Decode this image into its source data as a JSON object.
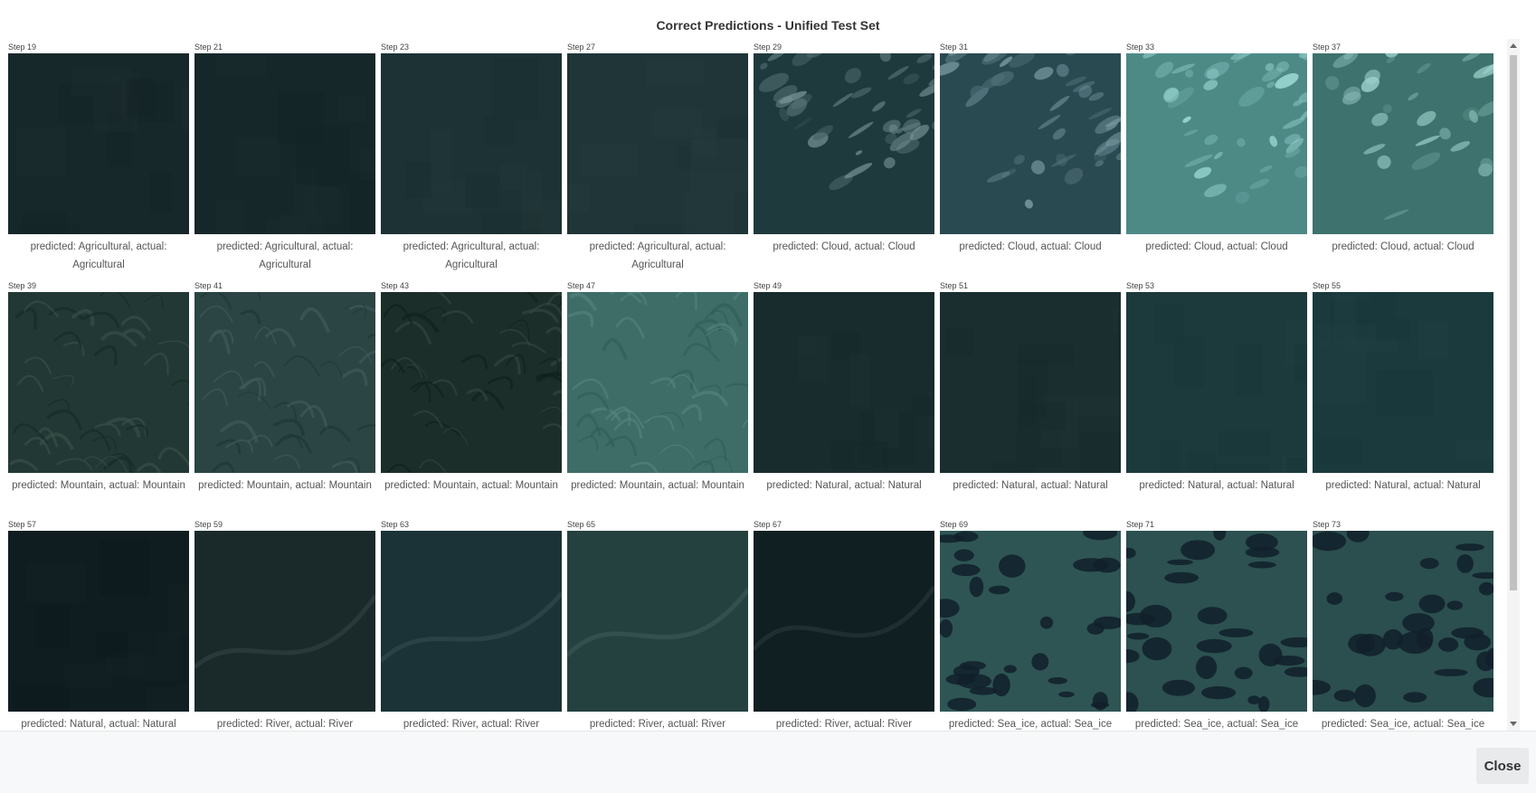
{
  "modal": {
    "title": "Correct Predictions - Unified Test Set",
    "close_label": "Close"
  },
  "panels": [
    {
      "step": "Step 19",
      "caption": "predicted: Agricultural, actual: Agricultural",
      "tone": "agri1"
    },
    {
      "step": "Step 21",
      "caption": "predicted: Agricultural, actual: Agricultural",
      "tone": "agri2"
    },
    {
      "step": "Step 23",
      "caption": "predicted: Agricultural, actual: Agricultural",
      "tone": "agri3"
    },
    {
      "step": "Step 27",
      "caption": "predicted: Agricultural, actual: Agricultural",
      "tone": "agri4"
    },
    {
      "step": "Step 29",
      "caption": "predicted: Cloud, actual: Cloud",
      "tone": "cloud1"
    },
    {
      "step": "Step 31",
      "caption": "predicted: Cloud, actual: Cloud",
      "tone": "cloud2"
    },
    {
      "step": "Step 33",
      "caption": "predicted: Cloud, actual: Cloud",
      "tone": "cloud3"
    },
    {
      "step": "Step 37",
      "caption": "predicted: Cloud, actual: Cloud",
      "tone": "cloud4"
    },
    {
      "step": "Step 39",
      "caption": "predicted: Mountain, actual: Mountain",
      "tone": "mtn1"
    },
    {
      "step": "Step 41",
      "caption": "predicted: Mountain, actual: Mountain",
      "tone": "mtn2"
    },
    {
      "step": "Step 43",
      "caption": "predicted: Mountain, actual: Mountain",
      "tone": "mtn3"
    },
    {
      "step": "Step 47",
      "caption": "predicted: Mountain, actual: Mountain",
      "tone": "mtn4"
    },
    {
      "step": "Step 49",
      "caption": "predicted: Natural, actual: Natural",
      "tone": "nat1"
    },
    {
      "step": "Step 51",
      "caption": "predicted: Natural, actual: Natural",
      "tone": "nat2"
    },
    {
      "step": "Step 53",
      "caption": "predicted: Natural, actual: Natural",
      "tone": "nat3"
    },
    {
      "step": "Step 55",
      "caption": "predicted: Natural, actual: Natural",
      "tone": "nat4"
    },
    {
      "step": "Step 57",
      "caption": "predicted: Natural, actual: Natural",
      "tone": "nat5"
    },
    {
      "step": "Step 59",
      "caption": "predicted: River, actual: River",
      "tone": "river1"
    },
    {
      "step": "Step 63",
      "caption": "predicted: River, actual: River",
      "tone": "river2"
    },
    {
      "step": "Step 65",
      "caption": "predicted: River, actual: River",
      "tone": "river3"
    },
    {
      "step": "Step 67",
      "caption": "predicted: River, actual: River",
      "tone": "river4"
    },
    {
      "step": "Step 69",
      "caption": "predicted: Sea_ice, actual: Sea_ice",
      "tone": "ice1"
    },
    {
      "step": "Step 71",
      "caption": "predicted: Sea_ice, actual: Sea_ice",
      "tone": "ice2"
    },
    {
      "step": "Step 73",
      "caption": "predicted: Sea_ice, actual: Sea_ice",
      "tone": "ice3"
    }
  ],
  "colors": {
    "agri1": "#17282a",
    "agri2": "#16272a",
    "agri3": "#1d3234",
    "agri4": "#1f3538",
    "cloud1": "#1f3a3d",
    "cloud2": "#2a4a52",
    "cloud3": "#4d8a86",
    "cloud4": "#3e726e",
    "mtn1": "#223834",
    "mtn2": "#2a4544",
    "mtn3": "#1c2e2a",
    "mtn4": "#3e6d68",
    "nat1": "#182b2d",
    "nat2": "#1a2e2f",
    "nat3": "#1c3a3c",
    "nat4": "#1a3a3d",
    "nat5": "#0f1d20",
    "river1": "#1a2a2b",
    "river2": "#1b3336",
    "river3": "#24413f",
    "river4": "#0f1f22",
    "ice1": "#2e5554",
    "ice2": "#2c5150",
    "ice3": "#2b4e4e"
  }
}
